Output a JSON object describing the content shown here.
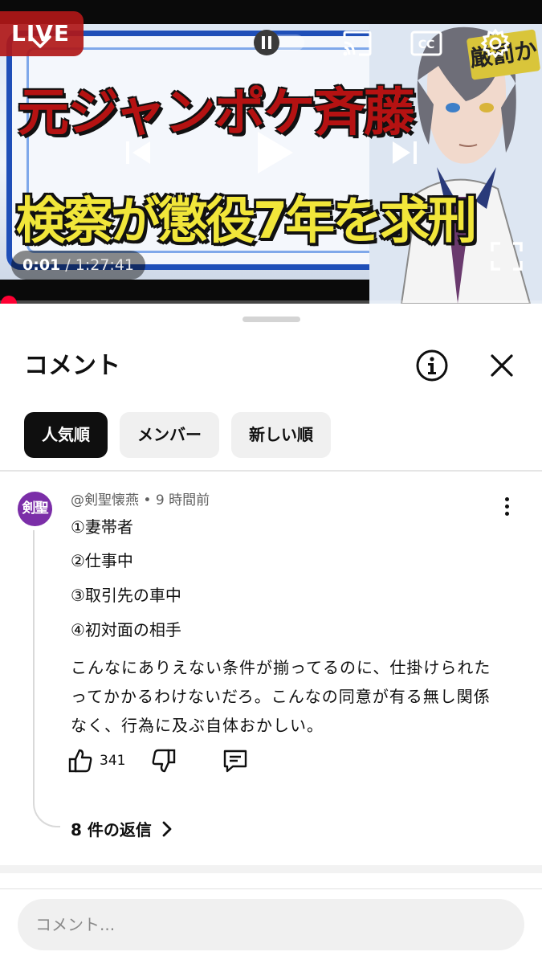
{
  "player": {
    "live_label": "LIVE",
    "thumbnail": {
      "line1": "元ジャンポケ斉藤",
      "line2": "検察が懲役7年を求刑",
      "stamp": "厳罰か"
    },
    "current_time": "0:01",
    "separator": " / ",
    "total_time": "1:27:41",
    "progress_fraction": 0.0002,
    "icons": [
      "chevron-down-icon",
      "pause-icon",
      "cast-icon",
      "captions-icon",
      "settings-icon",
      "previous-icon",
      "play-icon",
      "next-icon",
      "fullscreen-icon"
    ]
  },
  "comments_panel": {
    "title": "コメント",
    "chips": [
      {
        "label": "人気順",
        "active": true
      },
      {
        "label": "メンバー",
        "active": false
      },
      {
        "label": "新しい順",
        "active": false
      }
    ],
    "comment": {
      "avatar_text": "剣聖",
      "author": "@剣聖懐燕",
      "dot": "•",
      "time": "9 時間前",
      "lines": [
        "①妻帯者",
        "②仕事中",
        "③取引先の車中",
        "④初対面の相手"
      ],
      "paragraph": "こんなにありえない条件が揃ってるのに、仕掛けられたってかかるわけないだろ。こんなの同意が有る無し関係なく、行為に及ぶ自体おかしい。",
      "like_count": "341",
      "replies_label": "8 件の返信"
    },
    "input_placeholder": "コメント..."
  },
  "colors": {
    "accent_red": "#ff0033",
    "avatar_purple": "#7b2ea8",
    "chip_active_bg": "#0f0f0f",
    "chip_bg": "#f0f0f0"
  }
}
